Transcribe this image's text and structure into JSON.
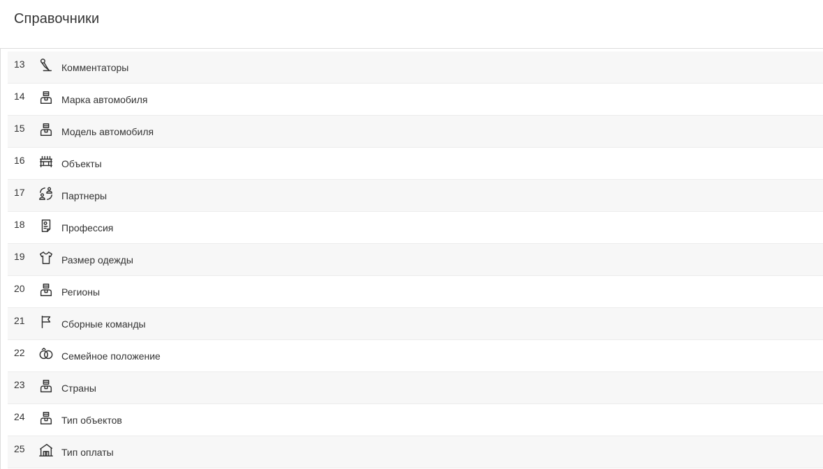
{
  "header": {
    "title": "Справочники"
  },
  "items": [
    {
      "number": "13",
      "label": "Комментаторы",
      "icon": "microphone-icon"
    },
    {
      "number": "14",
      "label": "Марка автомобиля",
      "icon": "person-icon"
    },
    {
      "number": "15",
      "label": "Модель автомобиля",
      "icon": "person-icon"
    },
    {
      "number": "16",
      "label": "Объекты",
      "icon": "building-icon"
    },
    {
      "number": "17",
      "label": "Партнеры",
      "icon": "partners-icon"
    },
    {
      "number": "18",
      "label": "Профессия",
      "icon": "badge-icon"
    },
    {
      "number": "19",
      "label": "Размер одежды",
      "icon": "tshirt-icon"
    },
    {
      "number": "20",
      "label": "Регионы",
      "icon": "person-icon"
    },
    {
      "number": "21",
      "label": "Сборные команды",
      "icon": "flag-icon"
    },
    {
      "number": "22",
      "label": "Семейное положение",
      "icon": "rings-icon"
    },
    {
      "number": "23",
      "label": "Страны",
      "icon": "person-icon"
    },
    {
      "number": "24",
      "label": "Тип объектов",
      "icon": "person-icon"
    },
    {
      "number": "25",
      "label": "Тип оплаты",
      "icon": "payment-icon"
    }
  ]
}
